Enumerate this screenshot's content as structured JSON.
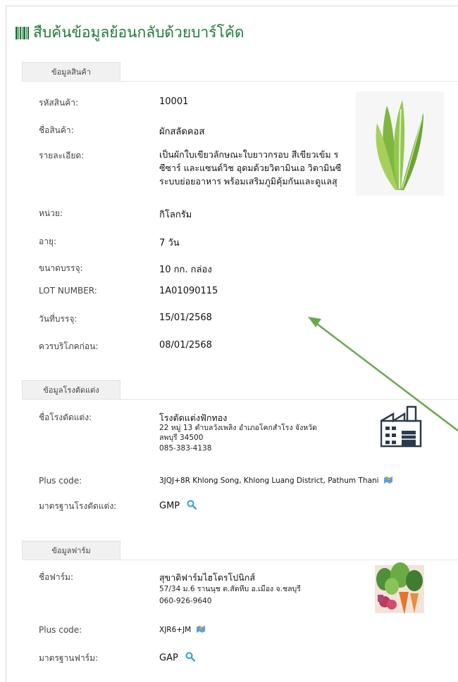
{
  "title": "สืบค้นข้อมูลย้อนกลับด้วยบาร์โค้ด",
  "product": {
    "tab": "ข้อมูลสินค้า",
    "code_label": "รหัสสินค้า:",
    "code": "10001",
    "name_label": "ชื่อสินค้า:",
    "name": "ผักสลัดคอส",
    "detail_label": "รายละเอียด:",
    "detail_lines": [
      "เป็นผักใบเขียวลักษณะใบยาวกรอบ สีเขียวเข้ม ร",
      "ซีซาร์ และแซนด์วิช อุดมด้วยวิตามินเอ วิตามินซี",
      "ระบบย่อยอาหาร พร้อมเสริมภูมิคุ้มกันและดูแลสุ"
    ],
    "unit_label": "หน่วย:",
    "unit": "กิโลกรัม",
    "age_label": "อายุ:",
    "age": "7 วัน",
    "pack_label": "ขนาดบรรจุ:",
    "pack": "10 กก. กล่อง",
    "lot_label": "LOT NUMBER:",
    "lot": "1A01090115",
    "packdate_label": "วันที่บรรจุ:",
    "packdate": "15/01/2568",
    "bestbefore_label": "ควรบริโภคก่อน:",
    "bestbefore": "08/01/2568"
  },
  "plant": {
    "tab": "ข้อมูลโรงตัดแต่ง",
    "name_label": "ชื่อโรงตัดแต่ง:",
    "name": "โรงตัดแต่งฟักทอง",
    "address1": "22 หมู่ 13 ตำบลวังเพลิง อำเภอโคกสำโรง จังหวัด",
    "address2": "ลพบุรี 34500",
    "phone": "085-383-4138",
    "pluscode_label": "Plus code:",
    "pluscode": "3JQJ+8R Khlong Song, Khlong Luang District, Pathum Thani",
    "standard_label": "มาตรฐานโรงตัดแต่ง:",
    "standard": "GMP"
  },
  "farm": {
    "tab": "ข้อมูลฟาร์ม",
    "name_label": "ชื่อฟาร์ม:",
    "name": "สุขาดิฟาร์มไฮโดรโปนิกส์",
    "address": "57/34 ม.6 รานนุช ต.สัตหีบ อ.เมือง จ.ชลบุรี",
    "phone": "060-926-9640",
    "pluscode_label": "Plus code:",
    "pluscode": "XJR6+JM",
    "standard_label": "มาตรฐานฟาร์ม:",
    "standard": "GAP"
  },
  "colors": {
    "brand": "#1f7a3a",
    "search": "#2a9fd8",
    "arrow": "#6aa84f"
  }
}
